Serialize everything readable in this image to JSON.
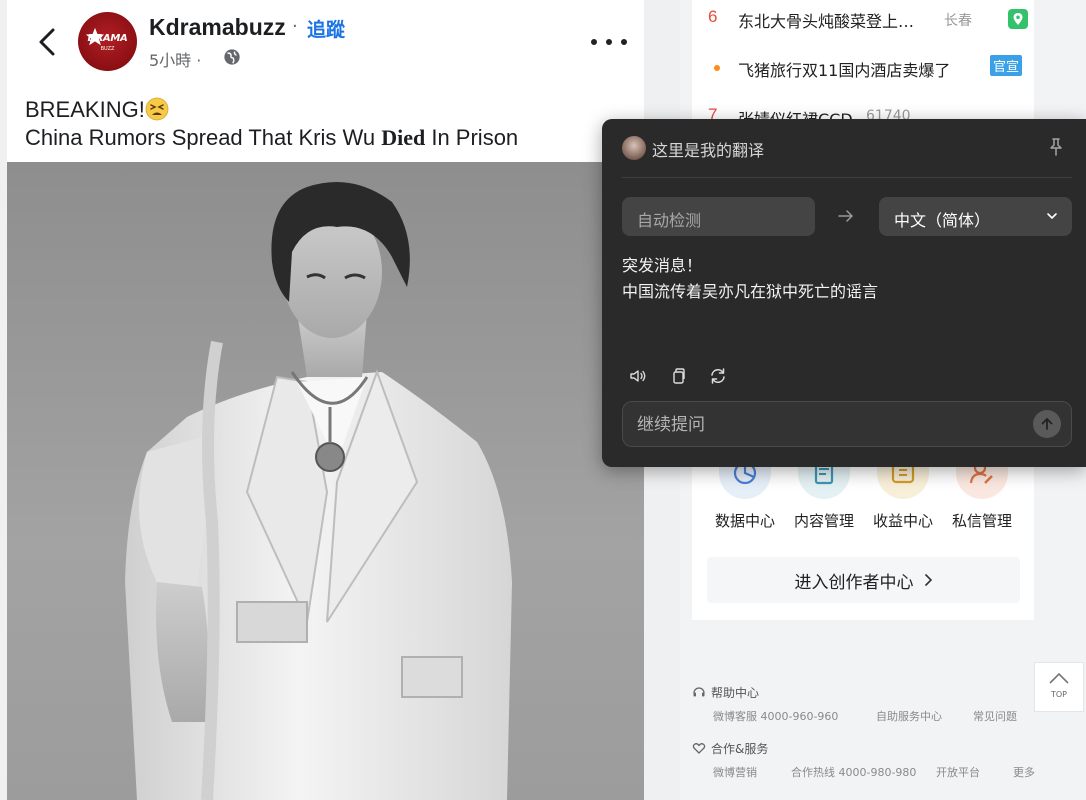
{
  "post": {
    "author_name": "Kdramabuzz",
    "follow_separator": "·",
    "follow_label": "追蹤",
    "time": "5小時 ·",
    "avatar_logo_text": "DRAMA",
    "avatar_logo_sub": "BUZZ",
    "headline_line1": "BREAKING!",
    "headline_line2_part1": "China Rumors Spread That Kris Wu ",
    "headline_line2_bold": "Died",
    "headline_line2_part2": " In Prison"
  },
  "sidebar": {
    "hot_list": [
      {
        "rank": "6",
        "title": "东北大骨头炖酸菜登上…",
        "extra": "长春",
        "badge": "",
        "geo": true,
        "type": "rank"
      },
      {
        "rank": "•",
        "title": "飞猪旅行双11国内酒店卖爆了",
        "extra": "",
        "badge": "官宣",
        "geo": false,
        "type": "dot"
      },
      {
        "rank": "7",
        "title": "张婧仪红裙CCD",
        "extra": "61740",
        "badge": "",
        "geo": false,
        "type": "rank"
      }
    ],
    "creator_items": [
      {
        "label": "数据中心",
        "icon": "pie-chart-icon",
        "bg": "#e6eef8",
        "color": "#4a7fd6"
      },
      {
        "label": "内容管理",
        "icon": "document-icon",
        "bg": "#e4f1f4",
        "color": "#3a97b5"
      },
      {
        "label": "收益中心",
        "icon": "wallet-icon",
        "bg": "#f8efd9",
        "color": "#d39b27"
      },
      {
        "label": "私信管理",
        "icon": "user-edit-icon",
        "bg": "#fae8e0",
        "color": "#e0733f"
      }
    ],
    "enter_creator_label": "进入创作者中心",
    "top_button_label": "TOP",
    "footer": {
      "help_title": "帮助中心",
      "help_links": [
        "微博客服 4000-960-960",
        "自助服务中心",
        "常见问题"
      ],
      "coop_title": "合作&服务",
      "coop_links": [
        "微博营销",
        "合作热线 4000-980-980",
        "开放平台",
        "更多"
      ]
    }
  },
  "translator": {
    "title": "这里是我的翻译",
    "source_language": "自动检测",
    "target_language": "中文（简体）",
    "result_line1": "突发消息！",
    "result_line2": "中国流传着吴亦凡在狱中死亡的谣言",
    "followup_placeholder": "继续提问"
  },
  "colors": {
    "facebook_blue": "#1b74e4",
    "hot_rank_red": "#e84a3a",
    "translator_bg": "#2a2a2a",
    "official_badge": "#3aa0e8"
  }
}
